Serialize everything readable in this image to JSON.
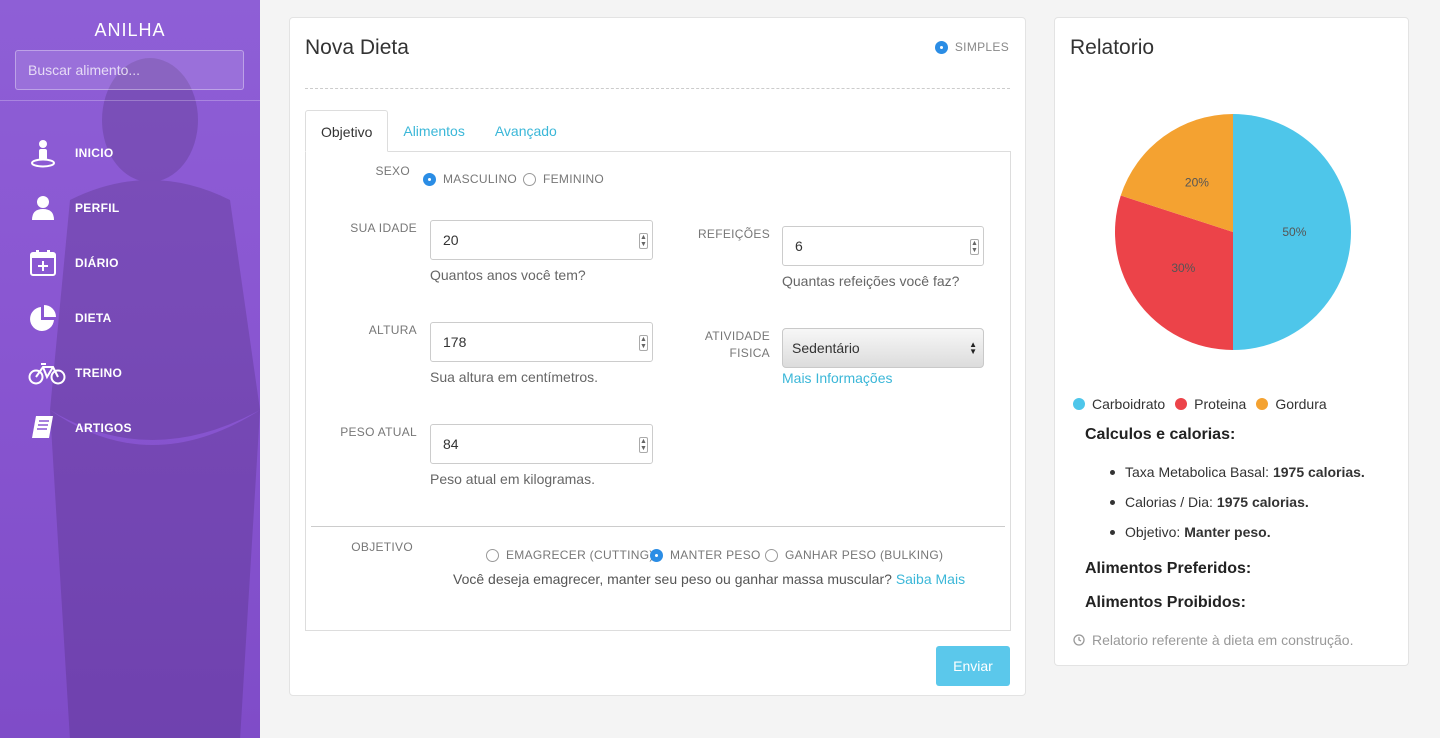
{
  "sidebar": {
    "brand": "ANILHA",
    "search_placeholder": "Buscar alimento...",
    "items": [
      {
        "label": "INICIO",
        "icon": "person-pin-icon"
      },
      {
        "label": "PERFIL",
        "icon": "user-icon"
      },
      {
        "label": "DIÁRIO",
        "icon": "calendar-add-icon"
      },
      {
        "label": "DIETA",
        "icon": "pie-chart-icon"
      },
      {
        "label": "TREINO",
        "icon": "bicycle-icon"
      },
      {
        "label": "ARTIGOS",
        "icon": "book-icon"
      }
    ]
  },
  "dieta": {
    "title": "Nova Dieta",
    "mode_label": "SIMPLES",
    "tabs": [
      "Objetivo",
      "Alimentos",
      "Avançado"
    ],
    "sexo": {
      "label": "SEXO",
      "options": [
        "MASCULINO",
        "FEMININO"
      ],
      "selected": "MASCULINO"
    },
    "idade": {
      "label": "SUA IDADE",
      "value": "20",
      "help": "Quantos anos você tem?"
    },
    "altura": {
      "label": "ALTURA",
      "value": "178",
      "help": "Sua altura em centímetros."
    },
    "peso": {
      "label": "PESO ATUAL",
      "value": "84",
      "help": "Peso atual em kilogramas."
    },
    "refeicoes": {
      "label": "REFEIÇÕES",
      "value": "6",
      "help": "Quantas refeições você faz?"
    },
    "atividade": {
      "label_line1": "ATIVIDADE",
      "label_line2": "FISICA",
      "value": "Sedentário",
      "link": "Mais Informações"
    },
    "objetivo": {
      "label": "OBJETIVO",
      "options": [
        "EMAGRECER (CUTTING)",
        "MANTER PESO",
        "GANHAR PESO (BULKING)"
      ],
      "selected": "MANTER PESO",
      "question": "Você deseja emagrecer, manter seu peso ou ganhar massa muscular?",
      "link": "Saiba Mais"
    },
    "submit": "Enviar"
  },
  "relatorio": {
    "title": "Relatorio",
    "calc_heading": "Calculos e calorias:",
    "items": [
      {
        "label": "Taxa Metabolica Basal:",
        "value": "1975 calorias."
      },
      {
        "label": "Calorias / Dia:",
        "value": "1975 calorias."
      },
      {
        "label": "Objetivo:",
        "value": "Manter peso."
      }
    ],
    "preferidos": "Alimentos Preferidos:",
    "proibidos": "Alimentos Proibidos:",
    "note": "Relatorio referente à dieta em construção."
  },
  "chart_data": {
    "type": "pie",
    "categories": [
      "Carboidrato",
      "Proteina",
      "Gordura"
    ],
    "values": [
      50,
      30,
      20
    ],
    "labels": [
      "50%",
      "30%",
      "20%"
    ],
    "colors": [
      "#4ec6ea",
      "#ec4349",
      "#f4a231"
    ],
    "legend": "bottom"
  }
}
